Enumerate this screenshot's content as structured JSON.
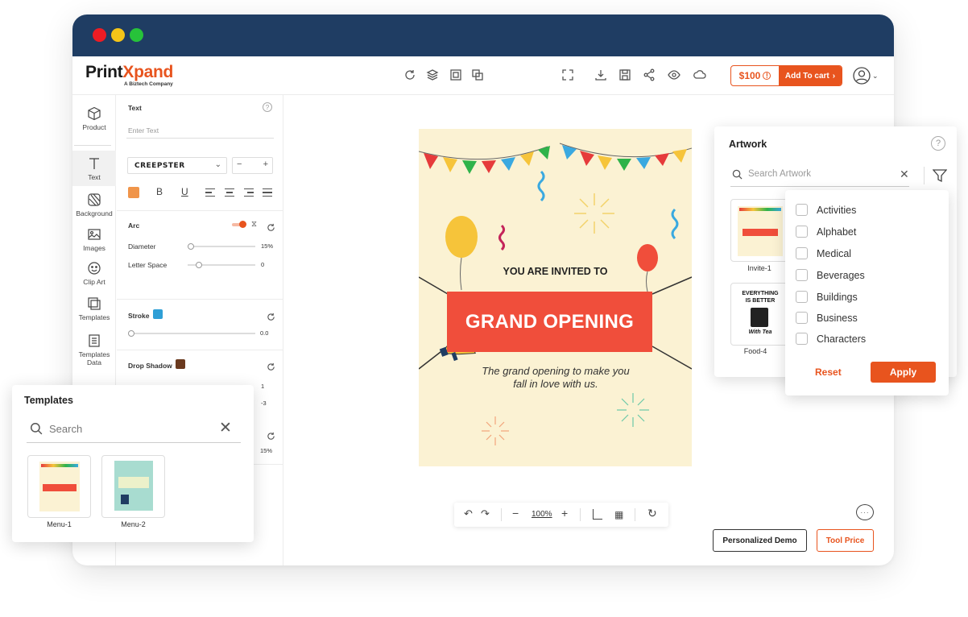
{
  "app": {
    "logo_main": "Print",
    "logo_accent": "X",
    "logo_rest": "pand",
    "logo_sub": "A Biztech Company"
  },
  "topbar": {
    "price": "$100",
    "add_to_cart": "Add To cart",
    "icons": [
      "refresh-icon",
      "layers-icon",
      "align-icon",
      "duplicate-icon",
      "fullscreen-icon",
      "download-icon",
      "save-icon",
      "share-icon",
      "preview-icon",
      "cloud-icon"
    ]
  },
  "sidenav": {
    "items": [
      {
        "label": "Product",
        "icon": "cube-icon"
      },
      {
        "label": "Text",
        "icon": "text-icon"
      },
      {
        "label": "Background",
        "icon": "background-icon"
      },
      {
        "label": "Images",
        "icon": "image-icon"
      },
      {
        "label": "Clip Art",
        "icon": "smiley-icon"
      },
      {
        "label": "Templates",
        "icon": "templates-icon"
      },
      {
        "label": "Templates Data",
        "icon": "templates-data-icon"
      }
    ]
  },
  "text_panel": {
    "title": "Text",
    "placeholder": "Enter Text",
    "font": "CREEPSTER",
    "arc_label": "Arc",
    "diameter_label": "Diameter",
    "diameter_value": "15%",
    "letter_space_label": "Letter Space",
    "letter_space_value": "0",
    "stroke_label": "Stroke",
    "stroke_value": "0.0",
    "drop_shadow_label": "Drop Shadow",
    "shadow_val1": "1",
    "shadow_val2": "-3",
    "shadow_val3": "15%",
    "colors": {
      "text": "#f0954a",
      "stroke": "#2f9fd6",
      "shadow": "#6b3a1f"
    }
  },
  "canvas": {
    "invite_line": "YOU ARE INVITED TO",
    "banner_text": "GRAND OPENING",
    "tagline_1": "The grand opening to make you",
    "tagline_2": "fall in love with us.",
    "zoom": "100%"
  },
  "buttons": {
    "demo": "Personalized Demo",
    "tool_price": "Tool Price"
  },
  "artwork": {
    "title": "Artwork",
    "search_placeholder": "Search Artwork",
    "thumb1_label": "Invite-1",
    "thumb2_label": "Food-4",
    "thumb2_line1": "EVERYTHING",
    "thumb2_line2": "IS BETTER",
    "thumb2_line3": "With Tea",
    "filters": [
      "Activities",
      "Alphabet",
      "Medical",
      "Beverages",
      "Buildings",
      "Business",
      "Characters"
    ],
    "reset": "Reset",
    "apply": "Apply"
  },
  "templates": {
    "title": "Templates",
    "search_placeholder": "Search",
    "items": [
      {
        "label": "Menu-1"
      },
      {
        "label": "Menu-2"
      }
    ]
  },
  "colors": {
    "accent": "#e8541e",
    "titlebar": "#1f3d63"
  }
}
